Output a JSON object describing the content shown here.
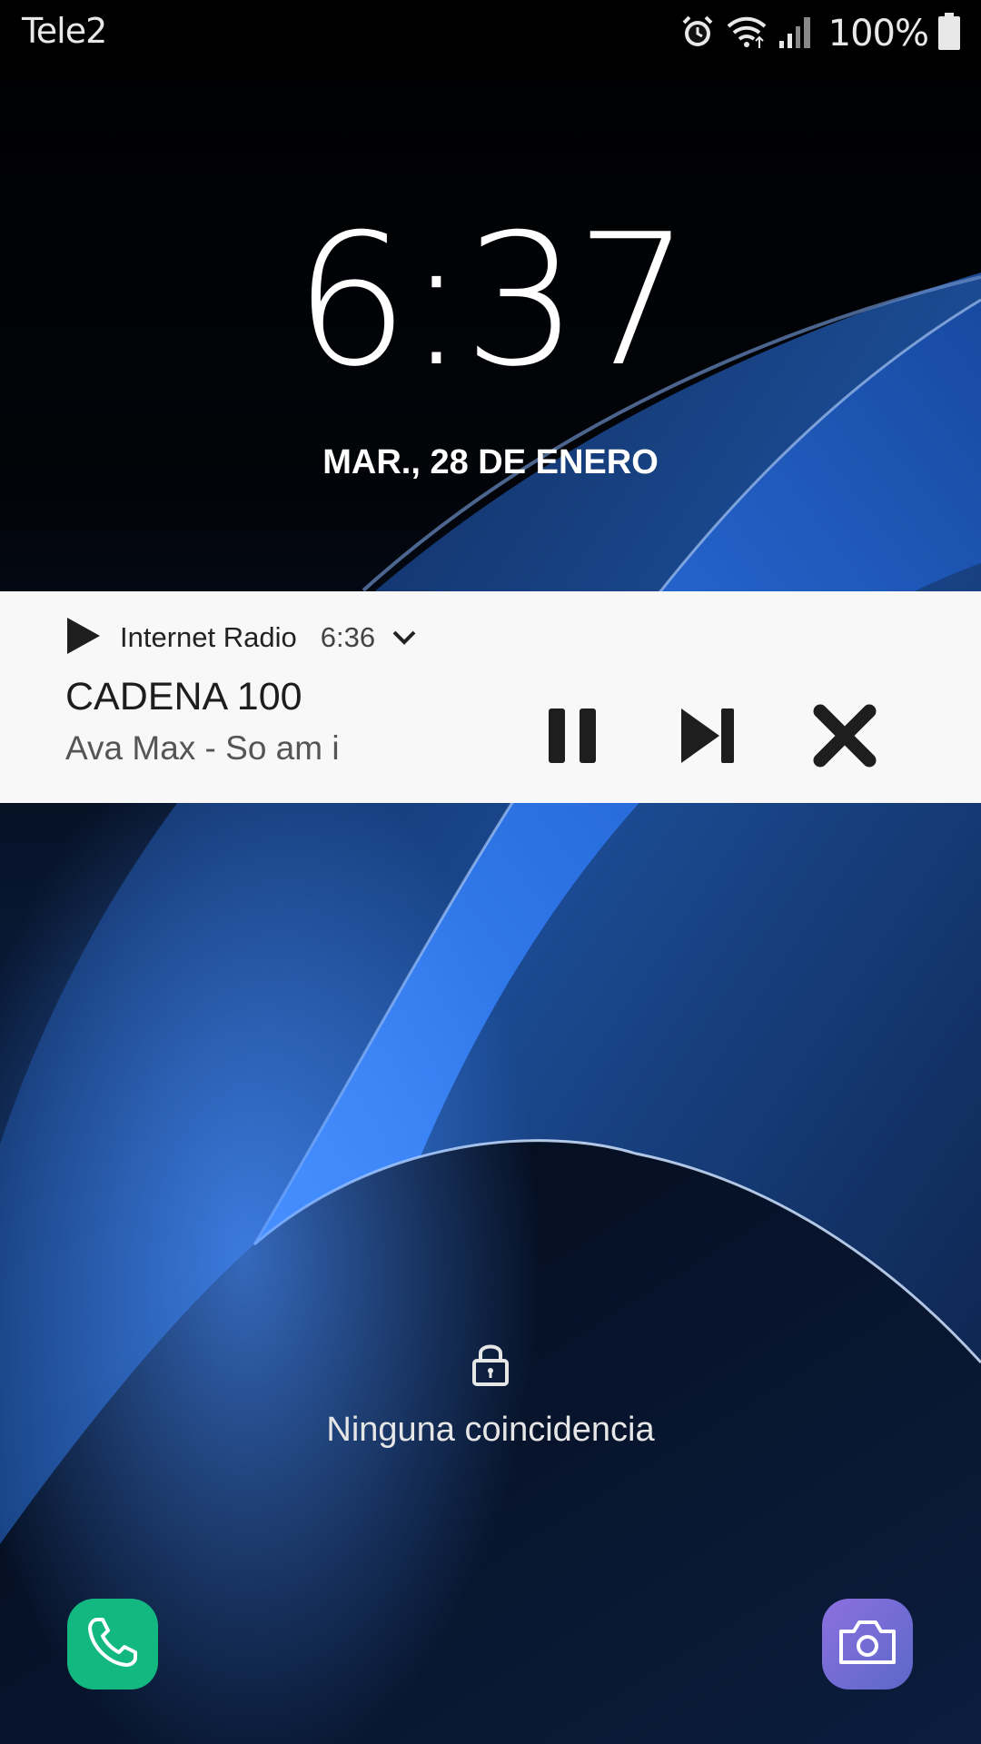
{
  "status_bar": {
    "carrier": "Tele2",
    "battery_percent": "100%",
    "icons": [
      "alarm-icon",
      "wifi-icon",
      "signal-icon",
      "battery-icon"
    ]
  },
  "lockscreen": {
    "time": "6:37",
    "date": "MAR., 28 DE ENERO"
  },
  "notification": {
    "app_name": "Internet Radio",
    "time": "6:36",
    "title": "CADENA 100",
    "subtitle": "Ava Max - So am i",
    "controls": [
      "pause-icon",
      "skip-next-icon",
      "close-icon"
    ]
  },
  "unlock": {
    "message": "Ninguna coincidencia",
    "icon": "lock-icon"
  },
  "shortcuts": {
    "left": "phone-icon",
    "right": "camera-icon",
    "colors": {
      "phone": "#13b880",
      "camera": "#7a6cd8"
    }
  }
}
